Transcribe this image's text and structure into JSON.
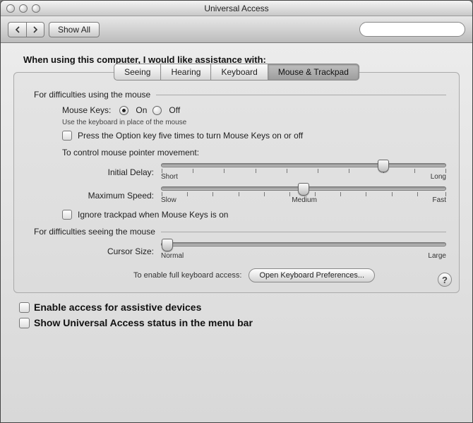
{
  "window": {
    "title": "Universal Access"
  },
  "toolbar": {
    "show_all": "Show All",
    "search_placeholder": ""
  },
  "heading": "When using this computer, I would like assistance with:",
  "tabs": {
    "seeing": "Seeing",
    "hearing": "Hearing",
    "keyboard": "Keyboard",
    "mouse": "Mouse & Trackpad",
    "active": "mouse"
  },
  "mouse": {
    "section_using": "For difficulties using the mouse",
    "keys_label": "Mouse Keys:",
    "on": "On",
    "off": "Off",
    "keys_value": "on",
    "keys_hint": "Use the keyboard in place of the mouse",
    "option_five": "Press the Option key five times to turn Mouse Keys on or off",
    "option_five_checked": false,
    "control_heading": "To control mouse pointer movement:",
    "initial_delay": {
      "label": "Initial Delay:",
      "min": "Short",
      "max": "Long",
      "value": 0.78
    },
    "max_speed": {
      "label": "Maximum Speed:",
      "min": "Slow",
      "mid": "Medium",
      "max": "Fast",
      "value": 0.5
    },
    "ignore_trackpad": "Ignore trackpad when Mouse Keys is on",
    "ignore_trackpad_checked": false,
    "section_seeing": "For difficulties seeing the mouse",
    "cursor_size": {
      "label": "Cursor Size:",
      "min": "Normal",
      "max": "Large",
      "value": 0.02
    },
    "kbd_access_label": "To enable full keyboard access:",
    "kbd_access_btn": "Open Keyboard Preferences..."
  },
  "help_glyph": "?",
  "footer": {
    "assistive": "Enable access for assistive devices",
    "assistive_checked": false,
    "menubar": "Show Universal Access status in the menu bar",
    "menubar_checked": false
  }
}
